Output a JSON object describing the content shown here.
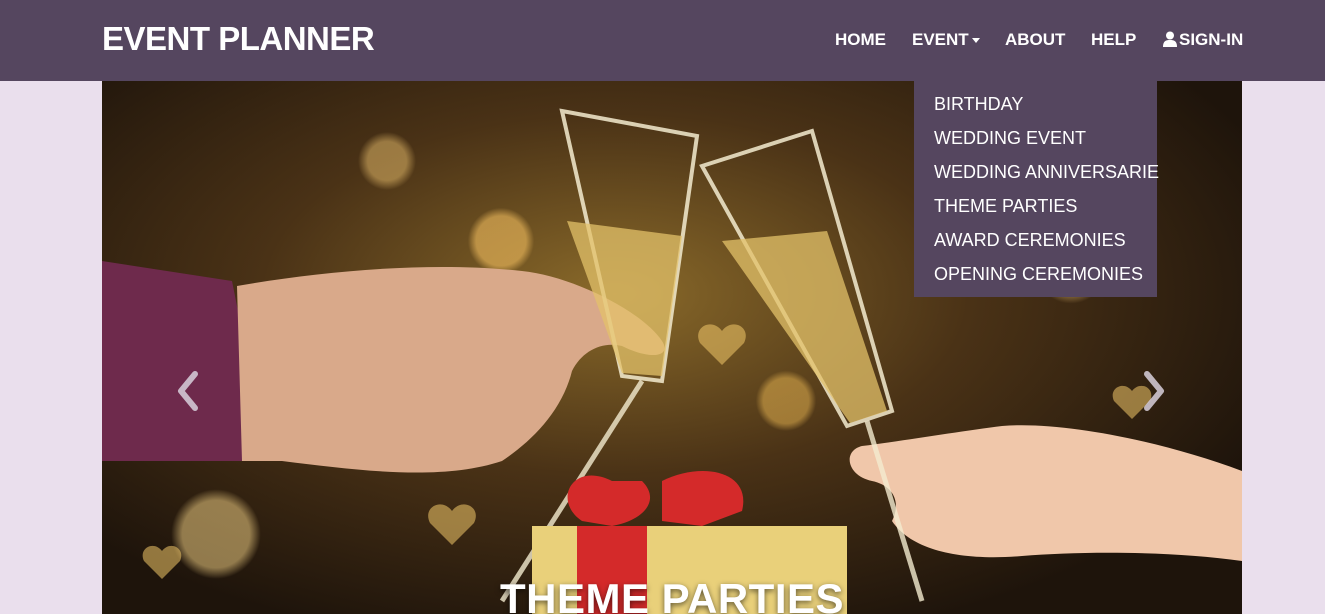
{
  "brand": "EVENT PLANNER",
  "nav": {
    "home": "HOME",
    "event": "EVENT",
    "about": "ABOUT",
    "help": "HELP",
    "signin": "SIGN-IN"
  },
  "dropdown": {
    "items": [
      "BIRTHDAY",
      "WEDDING EVENT",
      "WEDDING ANNIVERSARIE",
      "THEME PARTIES",
      "AWARD CEREMONIES",
      "OPENING CEREMONIES"
    ]
  },
  "carousel": {
    "caption": "THEME PARTIES",
    "prev_icon": "chevron-left-icon",
    "next_icon": "chevron-right-icon"
  },
  "colors": {
    "navbar": "#55465f",
    "page_background": "#eadfed",
    "text": "#ffffff"
  }
}
